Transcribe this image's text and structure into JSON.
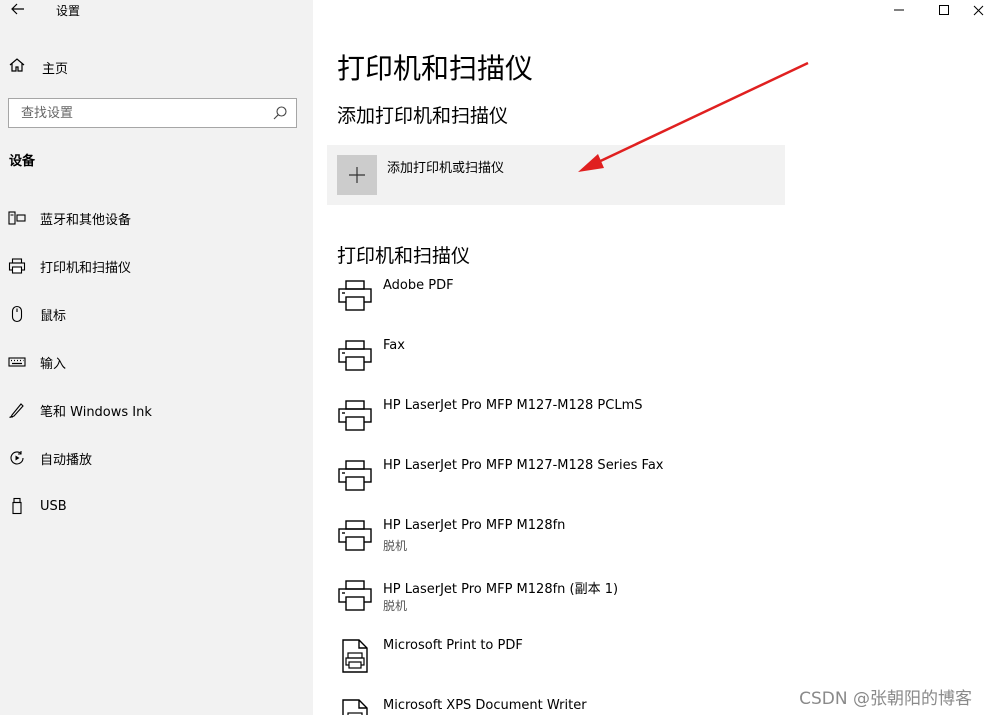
{
  "window": {
    "title": "设置",
    "back_icon": "back-arrow-icon",
    "minimize_icon": "minimize-icon",
    "maximize_icon": "maximize-icon",
    "close_icon": "close-icon"
  },
  "sidebar": {
    "home_label": "主页",
    "search_placeholder": "查找设置",
    "section_title": "设备",
    "items": [
      {
        "label": "蓝牙和其他设备",
        "icon": "bluetooth-devices-icon"
      },
      {
        "label": "打印机和扫描仪",
        "icon": "printer-icon"
      },
      {
        "label": "鼠标",
        "icon": "mouse-icon"
      },
      {
        "label": "输入",
        "icon": "keyboard-icon"
      },
      {
        "label": "笔和 Windows Ink",
        "icon": "pen-icon"
      },
      {
        "label": "自动播放",
        "icon": "autoplay-icon"
      },
      {
        "label": "USB",
        "icon": "usb-icon"
      }
    ]
  },
  "main": {
    "page_title": "打印机和扫描仪",
    "add_section_title": "添加打印机和扫描仪",
    "add_button_label": "添加打印机或扫描仪",
    "list_section_title": "打印机和扫描仪",
    "printers": [
      {
        "name": "Adobe PDF",
        "status": "",
        "icon": "printer-icon"
      },
      {
        "name": "Fax",
        "status": "",
        "icon": "printer-icon"
      },
      {
        "name": "HP LaserJet Pro MFP M127-M128 PCLmS",
        "status": "",
        "icon": "printer-icon"
      },
      {
        "name": "HP LaserJet Pro MFP M127-M128 Series Fax",
        "status": "",
        "icon": "printer-icon"
      },
      {
        "name": "HP LaserJet Pro MFP M128fn",
        "status": "脱机",
        "icon": "printer-icon"
      },
      {
        "name": "HP LaserJet Pro MFP M128fn (副本 1)",
        "status": "脱机",
        "icon": "printer-icon"
      },
      {
        "name": "Microsoft Print to PDF",
        "status": "",
        "icon": "pdf-printer-icon"
      },
      {
        "name": "Microsoft XPS Document Writer",
        "status": "",
        "icon": "xps-printer-icon"
      }
    ]
  },
  "annotation": {
    "arrow_color": "#e02020"
  },
  "watermark": "CSDN @张朝阳的博客"
}
